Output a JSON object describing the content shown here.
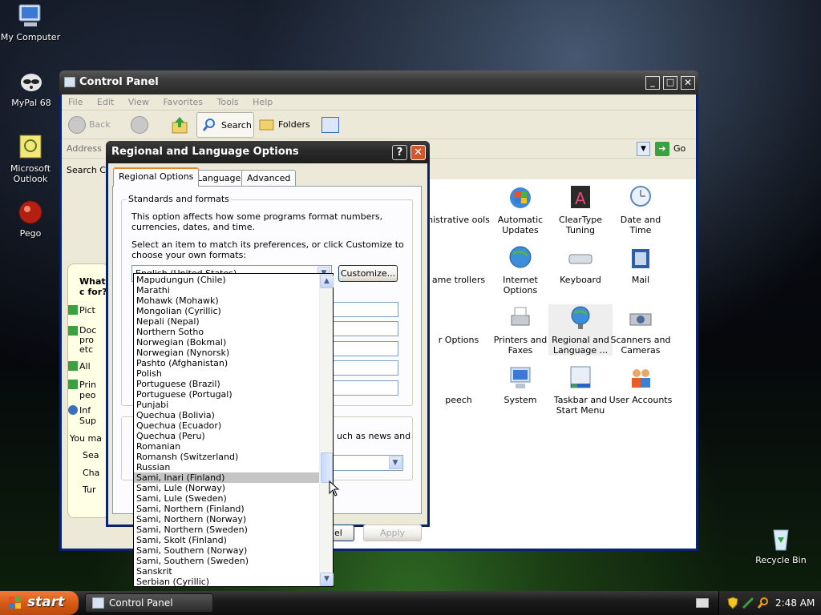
{
  "desktop": {
    "icons": [
      {
        "label": "My Computer"
      },
      {
        "label": "MyPal 68"
      },
      {
        "label": "Microsoft Outlook"
      },
      {
        "label": "Pego"
      },
      {
        "label": "Recycle Bin"
      }
    ]
  },
  "control_panel": {
    "title": "Control Panel",
    "menu": [
      "File",
      "Edit",
      "View",
      "Favorites",
      "Tools",
      "Help"
    ],
    "toolbar": {
      "back": "Back",
      "search": "Search",
      "folders": "Folders"
    },
    "address_label": "Address",
    "go_label": "Go",
    "search_label": "Search Co",
    "left_panel": {
      "heading": "What c for?",
      "items": [
        "Pict",
        "Doc pro etc",
        "All",
        "Prin peo",
        "Inf Sup"
      ],
      "you_may": "You ma",
      "links": [
        "Sea",
        "Cha",
        "Tur"
      ]
    },
    "items": [
      {
        "label": "nistrative ools"
      },
      {
        "label": "Automatic Updates"
      },
      {
        "label": "ClearType Tuning"
      },
      {
        "label": "Date and Time"
      },
      {
        "label": "ame trollers"
      },
      {
        "label": "Internet Options"
      },
      {
        "label": "Keyboard"
      },
      {
        "label": "Mail"
      },
      {
        "label": "r Options"
      },
      {
        "label": "Printers and Faxes"
      },
      {
        "label": "Regional and Language ..."
      },
      {
        "label": "Scanners and Cameras"
      },
      {
        "label": "peech"
      },
      {
        "label": "System"
      },
      {
        "label": "Taskbar and Start Menu"
      },
      {
        "label": "User Accounts"
      }
    ]
  },
  "dialog": {
    "title": "Regional and Language Options",
    "tabs": [
      "Regional Options",
      "Languages",
      "Advanced"
    ],
    "group_title": "Standards and formats",
    "description": "This option affects how some programs format numbers, currencies, dates, and time.",
    "instruction": "Select an item to match its preferences, or click Customize to choose your own formats:",
    "selected_locale": "English (United States)",
    "customize_label": "Customize...",
    "location_partial": "uch as news and",
    "cancel_partial": "el",
    "apply_label": "Apply",
    "locale_list": [
      "Mapudungun (Chile)",
      "Marathi",
      "Mohawk (Mohawk)",
      "Mongolian (Cyrillic)",
      "Nepali (Nepal)",
      "Northern Sotho",
      "Norwegian (Bokmal)",
      "Norwegian (Nynorsk)",
      "Pashto (Afghanistan)",
      "Polish",
      "Portuguese (Brazil)",
      "Portuguese (Portugal)",
      "Punjabi",
      "Quechua (Bolivia)",
      "Quechua (Ecuador)",
      "Quechua (Peru)",
      "Romanian",
      "Romansh (Switzerland)",
      "Russian",
      "Sami, Inari (Finland)",
      "Sami, Lule (Norway)",
      "Sami, Lule (Sweden)",
      "Sami, Northern (Finland)",
      "Sami, Northern (Norway)",
      "Sami, Northern (Sweden)",
      "Sami, Skolt (Finland)",
      "Sami, Southern (Norway)",
      "Sami, Southern (Sweden)",
      "Sanskrit",
      "Serbian (Cyrillic)"
    ],
    "highlighted_index": 19
  },
  "taskbar": {
    "start_label": "start",
    "task_label": "Control Panel",
    "clock": "2:48 AM"
  }
}
